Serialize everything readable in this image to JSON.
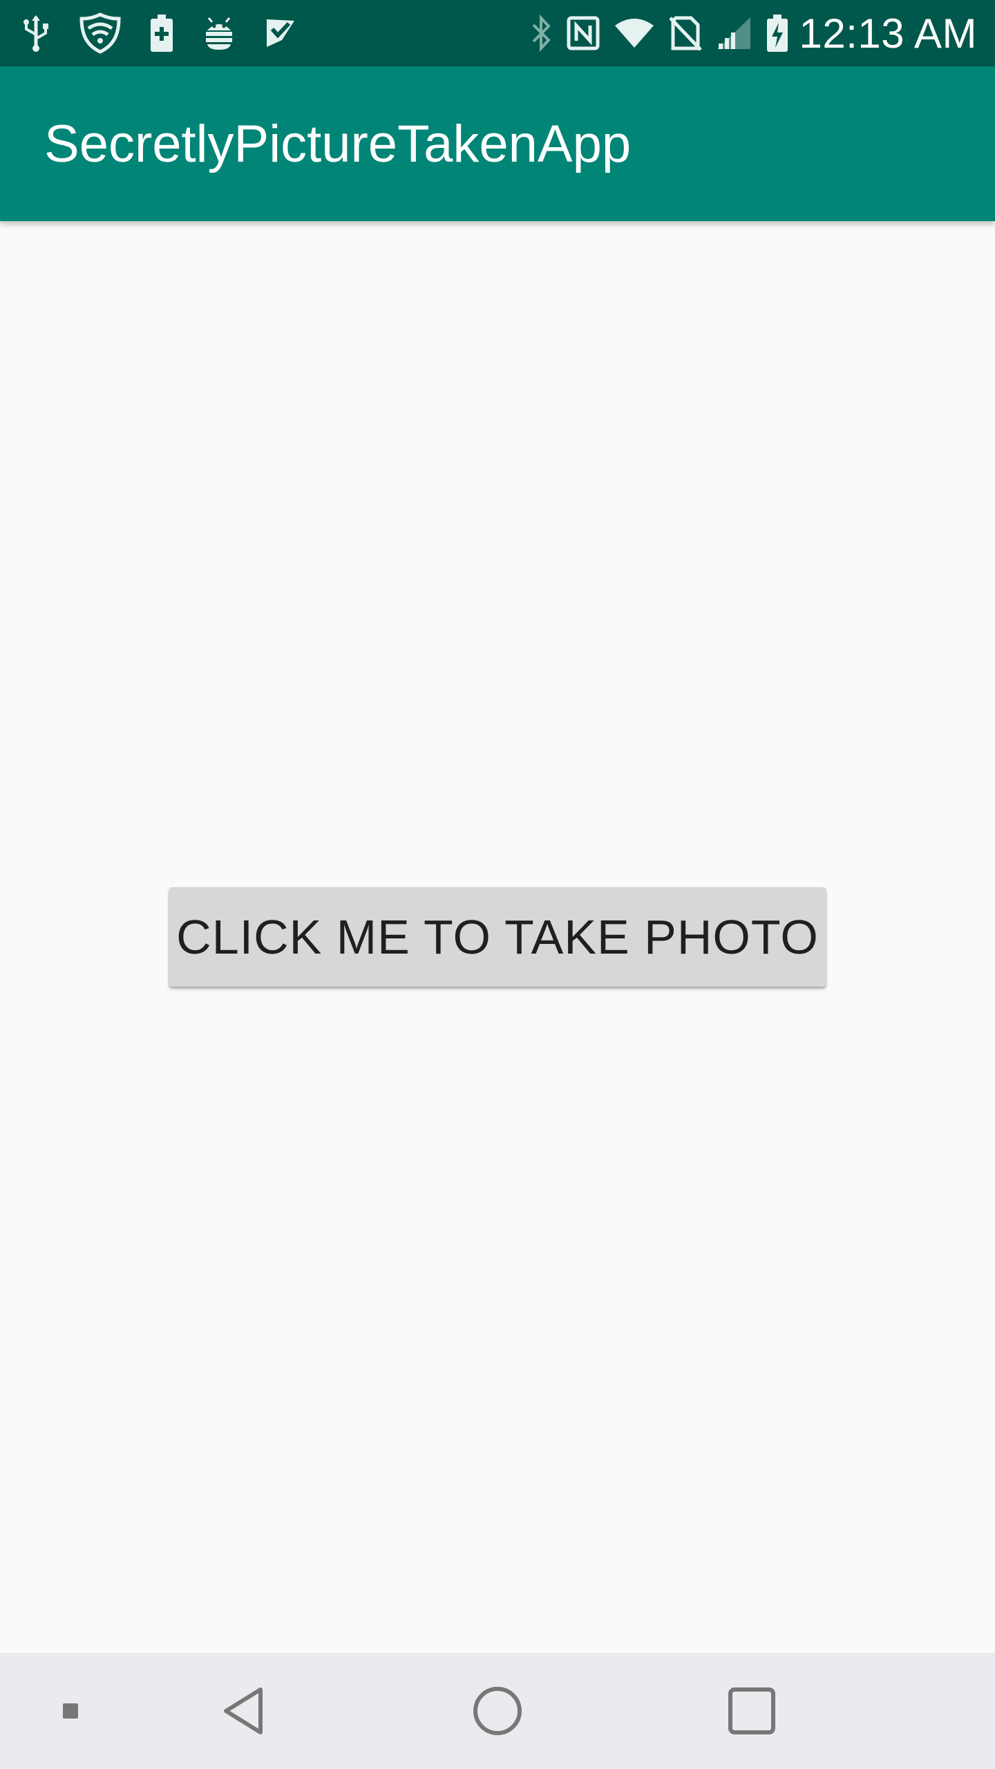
{
  "status_bar": {
    "left_icons": [
      "usb-icon",
      "vpn-shield-icon",
      "battery-saver-icon",
      "android-debug-icon",
      "task-check-icon"
    ],
    "right_icons": [
      "bluetooth-icon",
      "nfc-icon",
      "wifi-icon",
      "no-sim-icon",
      "cell-signal-icon",
      "battery-charging-icon"
    ],
    "time": "12:13 AM",
    "background_color": "#00574b"
  },
  "app_bar": {
    "title": "SecretlyPictureTakenApp",
    "background_color": "#008577"
  },
  "main": {
    "take_photo_button_label": "CLICK ME TO TAKE PHOTO",
    "background_color": "#fafafa"
  },
  "nav_bar": {
    "icons": [
      "screen-pin-icon",
      "back-icon",
      "home-icon",
      "recents-icon"
    ],
    "background_color": "#ebebef"
  }
}
